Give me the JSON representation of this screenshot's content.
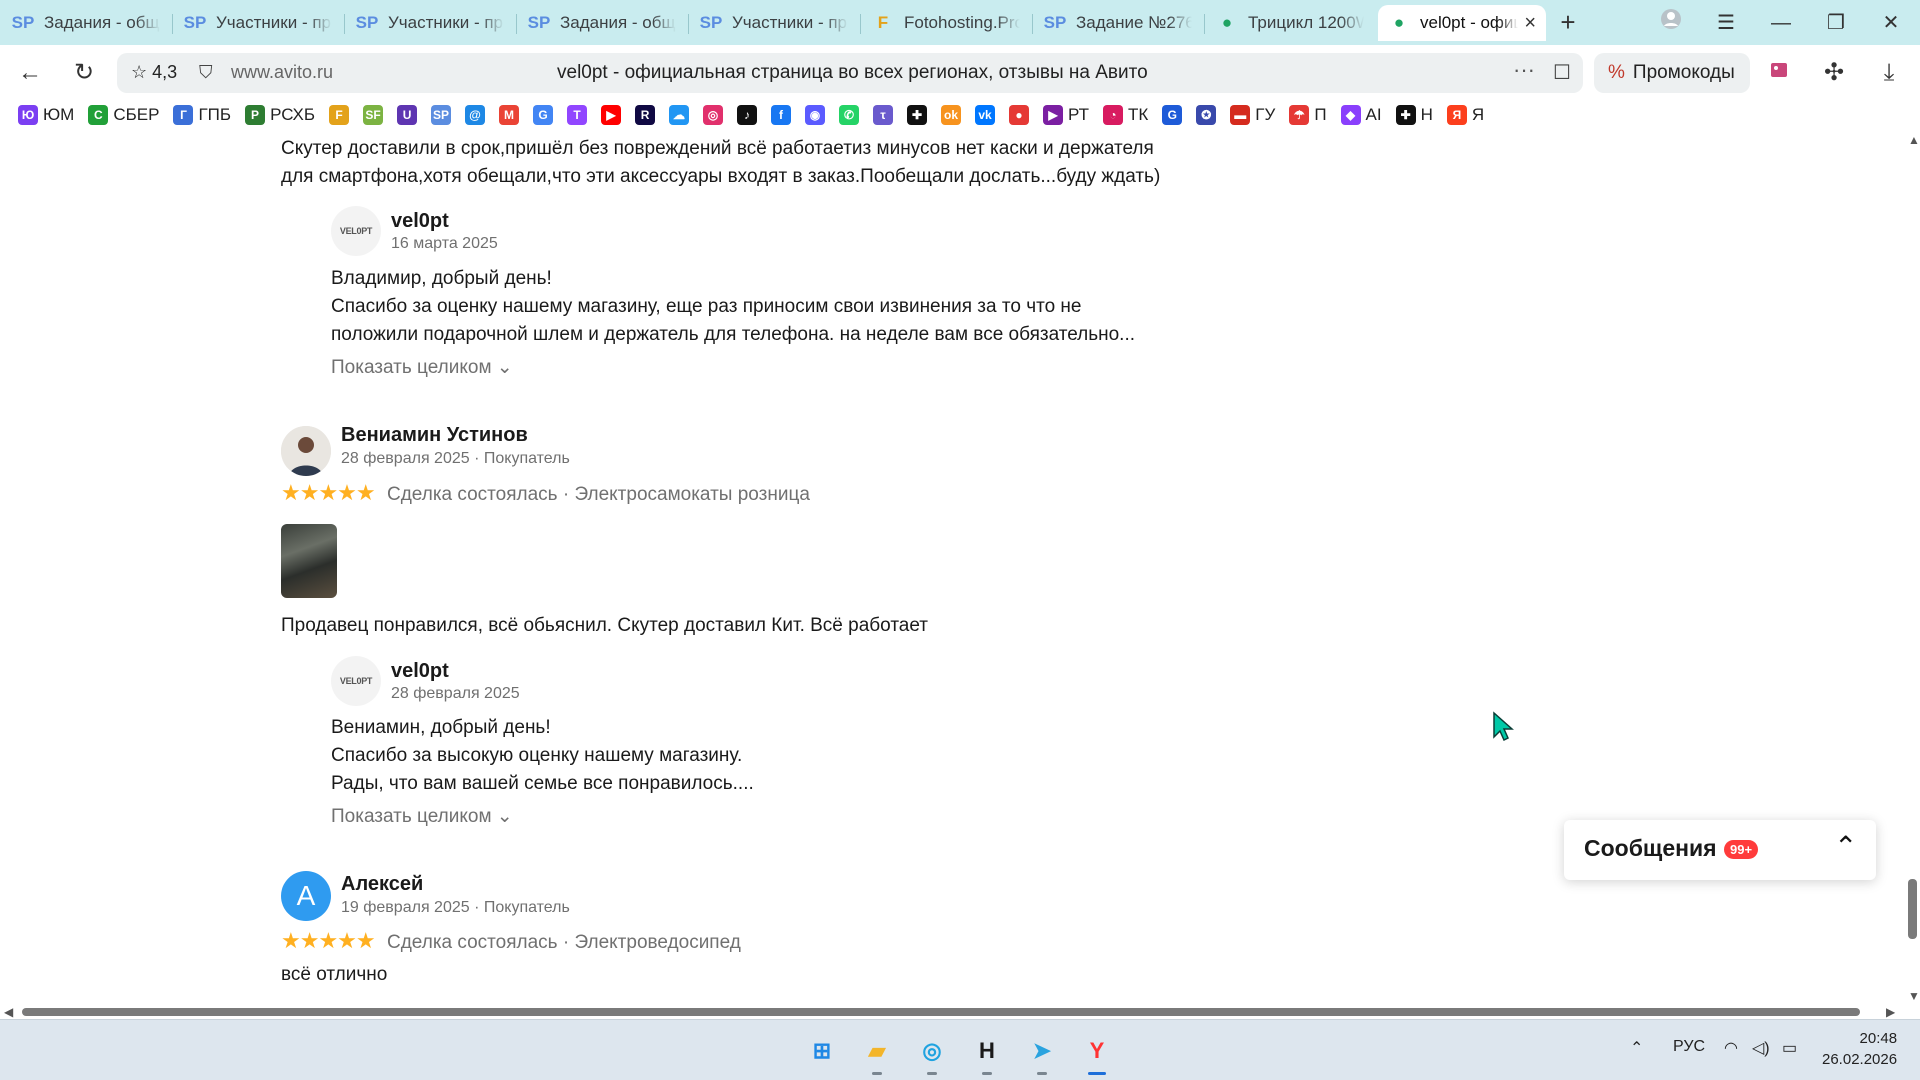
{
  "browser": {
    "tabs": [
      {
        "icon": "sp-icon",
        "glyph": "SP",
        "color": "#5b8de0",
        "label": "Задания - общ",
        "active": false
      },
      {
        "icon": "sp-icon",
        "glyph": "SP",
        "color": "#5b8de0",
        "label": "Участники - пр",
        "active": false
      },
      {
        "icon": "sp-icon",
        "glyph": "SP",
        "color": "#5b8de0",
        "label": "Участники - пр",
        "active": false
      },
      {
        "icon": "sp-icon",
        "glyph": "SP",
        "color": "#5b8de0",
        "label": "Задания - общ",
        "active": false
      },
      {
        "icon": "sp-icon",
        "glyph": "SP",
        "color": "#5b8de0",
        "label": "Участники - пр",
        "active": false
      },
      {
        "icon": "fotohosting-icon",
        "glyph": "F",
        "color": "#e3a21a",
        "label": "Fotohosting.Pro",
        "active": false
      },
      {
        "icon": "sp-icon",
        "glyph": "SP",
        "color": "#5b8de0",
        "label": "Задание №276",
        "active": false
      },
      {
        "icon": "avito-icon",
        "glyph": "●",
        "color": "#1fa463",
        "label": "Трицикл 1200W",
        "active": false
      },
      {
        "icon": "avito-icon",
        "glyph": "●",
        "color": "#1fa463",
        "label": "vel0pt - офици",
        "active": true
      }
    ],
    "address": {
      "rating": "4,3",
      "domain": "www.avito.ru",
      "title": "vel0pt - официальная страница во всех регионах, отзывы на Авито"
    },
    "promo_label": "Промокоды",
    "bookmarks": [
      {
        "label": "ЮМ",
        "icon": "yumoney-icon",
        "glyph": "Ю",
        "color": "#7b3ff2"
      },
      {
        "label": "СБЕР",
        "icon": "sber-icon",
        "glyph": "С",
        "color": "#21a038"
      },
      {
        "label": "ГПБ",
        "icon": "gpb-icon",
        "glyph": "Г",
        "color": "#3b6fd8"
      },
      {
        "label": "РСХБ",
        "icon": "rshb-icon",
        "glyph": "Р",
        "color": "#2e7d32"
      },
      {
        "label": "",
        "icon": "f-icon",
        "glyph": "F",
        "color": "#e3a21a"
      },
      {
        "label": "",
        "icon": "sf-icon",
        "glyph": "SF",
        "color": "#7cb342"
      },
      {
        "label": "",
        "icon": "shield-bm-icon",
        "glyph": "U",
        "color": "#5e35b1"
      },
      {
        "label": "",
        "icon": "sp-bm-icon",
        "glyph": "SP",
        "color": "#5b8de0"
      },
      {
        "label": "",
        "icon": "mail-ru-icon",
        "glyph": "@",
        "color": "#1e88e5"
      },
      {
        "label": "",
        "icon": "gmail-icon",
        "glyph": "M",
        "color": "#ea4335"
      },
      {
        "label": "",
        "icon": "google-icon",
        "glyph": "G",
        "color": "#4285f4"
      },
      {
        "label": "",
        "icon": "twitch-icon",
        "glyph": "T",
        "color": "#9146ff"
      },
      {
        "label": "",
        "icon": "youtube-icon",
        "glyph": "▶",
        "color": "#ff0000"
      },
      {
        "label": "",
        "icon": "rutube-icon",
        "glyph": "R",
        "color": "#100943"
      },
      {
        "label": "",
        "icon": "cloud-icon",
        "glyph": "☁",
        "color": "#2196f3"
      },
      {
        "label": "",
        "icon": "instagram-icon",
        "glyph": "◎",
        "color": "#e1306c"
      },
      {
        "label": "",
        "icon": "tiktok-icon",
        "glyph": "♪",
        "color": "#111111"
      },
      {
        "label": "",
        "icon": "facebook-icon",
        "glyph": "f",
        "color": "#1877f2"
      },
      {
        "label": "",
        "icon": "messenger-icon",
        "glyph": "◉",
        "color": "#5b5bff"
      },
      {
        "label": "",
        "icon": "whatsapp-icon",
        "glyph": "✆",
        "color": "#25d366"
      },
      {
        "label": "",
        "icon": "tensor-icon",
        "glyph": "τ",
        "color": "#6a5acd"
      },
      {
        "label": "",
        "icon": "plus-bm-icon",
        "glyph": "✚",
        "color": "#111111"
      },
      {
        "label": "",
        "icon": "ok-icon",
        "glyph": "ok",
        "color": "#f7931e"
      },
      {
        "label": "",
        "icon": "vk-icon",
        "glyph": "vk",
        "color": "#0077ff"
      },
      {
        "label": "",
        "icon": "record-icon",
        "glyph": "●",
        "color": "#e53935"
      },
      {
        "label": "РТ",
        "icon": "rt-icon",
        "glyph": "▶",
        "color": "#7b1fa2"
      },
      {
        "label": "ТК",
        "icon": "tk-icon",
        "glyph": "◔",
        "color": "#d81b60"
      },
      {
        "label": "",
        "icon": "spin-icon",
        "glyph": "G",
        "color": "#1e5bd8"
      },
      {
        "label": "",
        "icon": "emblem-icon",
        "glyph": "✪",
        "color": "#3949ab"
      },
      {
        "label": "ГУ",
        "icon": "flag-ru-icon",
        "glyph": "▬",
        "color": "#d52b1e"
      },
      {
        "label": "П",
        "icon": "umbrella-icon",
        "glyph": "☂",
        "color": "#e53935"
      },
      {
        "label": "AI",
        "icon": "alice-icon",
        "glyph": "◆",
        "color": "#8a3ffc"
      },
      {
        "label": "Н",
        "icon": "plus-n-icon",
        "glyph": "✚",
        "color": "#111111"
      },
      {
        "label": "Я",
        "icon": "yandex-icon",
        "glyph": "Я",
        "color": "#fc3f1d"
      }
    ]
  },
  "reviews": {
    "top_text": [
      "Скутер доставили в срок,пришёл без повреждений всё работаетиз минусов нет каски и держателя",
      "для смартфона,хотя обещали,что эти аксессуары входят в заказ.Пообещали дослать...буду ждать)"
    ],
    "reply1": {
      "avatar_text": "VEL0PT",
      "name": "vel0pt",
      "date": "16 марта 2025",
      "lines": [
        "Владимир, добрый день!",
        "Спасибо за оценку нашему магазину, еще раз приносим свои извинения за то что не",
        "положили подарочной шлем и держатель для телефона. на неделе вам все обязательно..."
      ],
      "show_full": "Показать целиком"
    },
    "review2": {
      "name": "Вениамин Устинов",
      "meta": "28 февраля 2025 · Покупатель",
      "stars": "★★★★★",
      "deal": "Сделка состоялась · Электросамокаты розница",
      "text": "Продавец понравился, всё обьяснил. Скутер доставил Кит. Всё работает"
    },
    "reply2": {
      "avatar_text": "VEL0PT",
      "name": "vel0pt",
      "date": "28 февраля 2025",
      "lines": [
        "Вениамин, добрый день!",
        "Спасибо за высокую оценку нашему магазину.",
        "Рады, что вам вашей семье все понравилось...."
      ],
      "show_full": "Показать целиком"
    },
    "review3": {
      "avatar_letter": "А",
      "name": "Алексей",
      "meta": "19 февраля 2025 · Покупатель",
      "stars": "★★★★★",
      "deal": "Сделка состоялась · Электроведосипед",
      "text": "всё отлично"
    }
  },
  "messages_widget": {
    "title": "Сообщения",
    "badge": "99+"
  },
  "taskbar": {
    "apps": [
      {
        "icon": "windows-start-icon",
        "glyph": "⊞",
        "color": "#1e88e5"
      },
      {
        "icon": "file-explorer-icon",
        "glyph": "▰",
        "color": "#f3b52a"
      },
      {
        "icon": "edge-browser-icon",
        "glyph": "◎",
        "color": "#1fa3e0"
      },
      {
        "icon": "h-app-icon",
        "glyph": "H",
        "color": "#1a1a1a"
      },
      {
        "icon": "telegram-icon",
        "glyph": "➤",
        "color": "#2aa3df"
      },
      {
        "icon": "yandex-browser-icon",
        "glyph": "Y",
        "color": "#ff3333"
      }
    ],
    "language": "РУС",
    "time": "20:48",
    "date": "26.02.2026"
  }
}
